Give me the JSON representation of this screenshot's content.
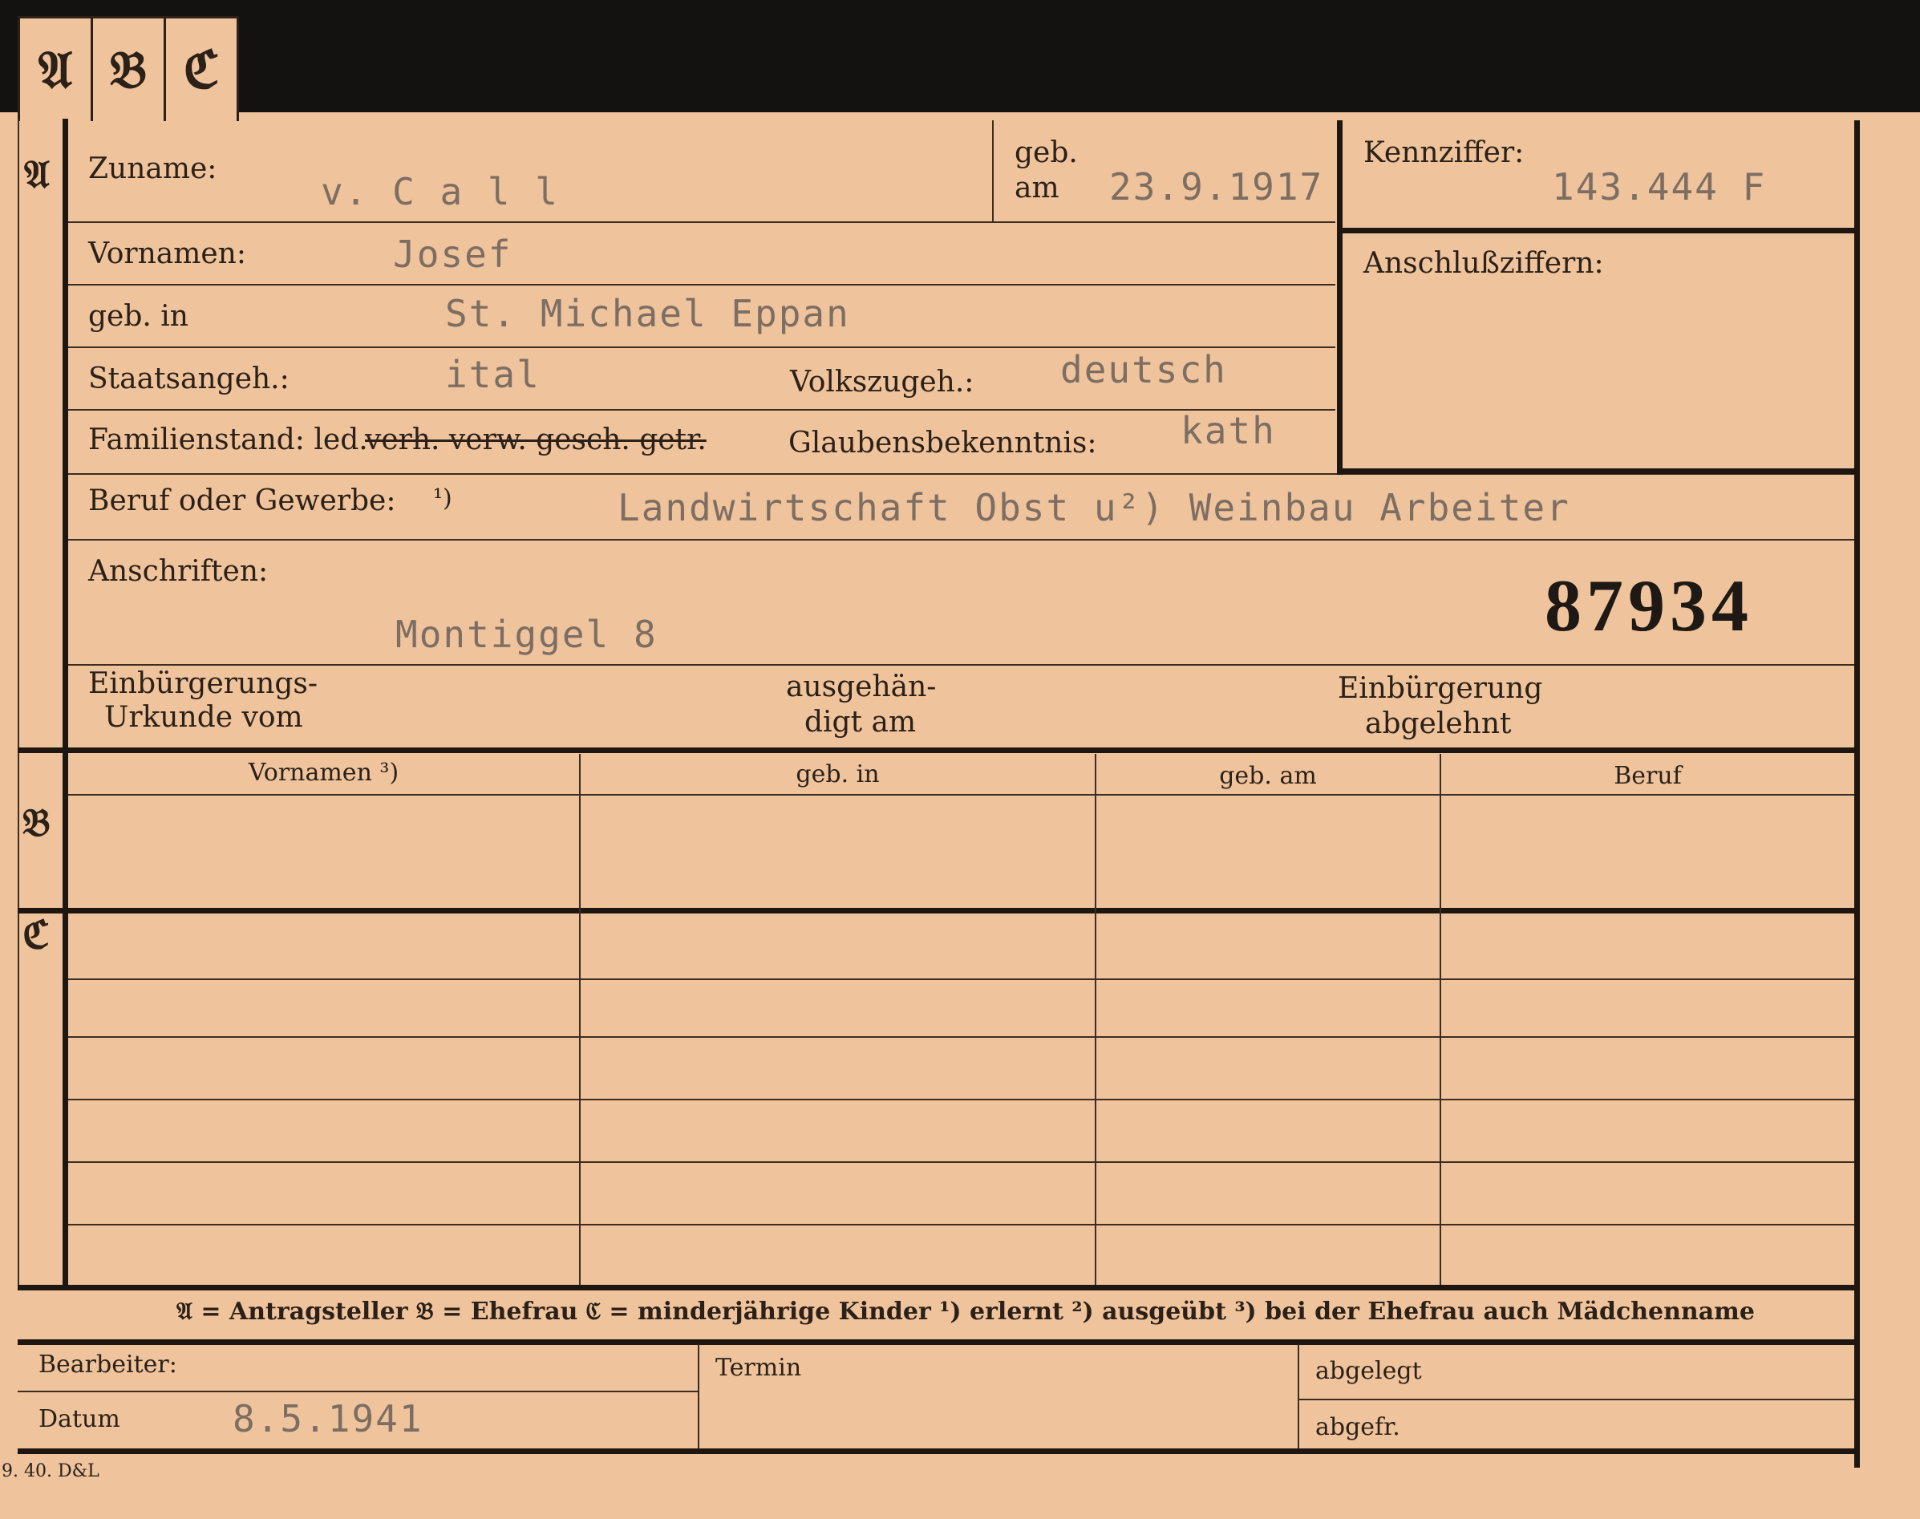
{
  "tabs": [
    "𝔄",
    "𝔅",
    "ℭ"
  ],
  "section_a": {
    "marker": "𝔄",
    "zuname_label": "Zuname:",
    "zuname_value": "v. C a l l",
    "geb_am_label_1": "geb.",
    "geb_am_label_2": "am",
    "geb_am_value": "23.9.1917",
    "kennziffer_label": "Kennziffer:",
    "kennziffer_value": "143.444  F",
    "vornamen_label": "Vornamen:",
    "vornamen_value": "Josef",
    "anschluss_label": "Anschlußziffern:",
    "geb_in_label": "geb. in",
    "geb_in_value": "St. Michael Eppan",
    "staatsangeh_label": "Staatsangeh.:",
    "staatsangeh_value": "ital",
    "volkszugeh_label": "Volkszugeh.:",
    "volkszugeh_value": "deutsch",
    "familienstand_label": "Familienstand: led.",
    "familienstand_struck": "verh. verw. gesch. getr.",
    "glauben_label": "Glaubensbekenntnis:",
    "glauben_value": "kath",
    "beruf_label": "Beruf oder Gewerbe:",
    "beruf_note": "¹)",
    "beruf_value": "Landwirtschaft Obst u²) Weinbau  Arbeiter",
    "anschriften_label": "Anschriften:",
    "anschriften_value": "Montiggel  8",
    "stamp_number": "87934",
    "einb_urkunde_1": "Einbürgerungs-",
    "einb_urkunde_2": "Urkunde vom",
    "ausgehaendigt_1": "ausgehän-",
    "ausgehaendigt_2": "digt am",
    "einb_abgelehnt_1": "Einbürgerung",
    "einb_abgelehnt_2": "abgelehnt"
  },
  "section_b": {
    "marker": "𝔅",
    "columns": [
      "Vornamen ³)",
      "geb. in",
      "geb. am",
      "Beruf"
    ]
  },
  "section_c": {
    "marker": "ℭ"
  },
  "legend": "𝔄 = Antragsteller   𝔅 = Ehefrau   ℭ = minderjährige Kinder   ¹) erlernt   ²) ausgeübt   ³) bei der Ehefrau auch Mädchenname",
  "footer": {
    "bearbeiter_label": "Bearbeiter:",
    "termin_label": "Termin",
    "abgelegt_label": "abgelegt",
    "datum_label": "Datum",
    "datum_value": "8.5.1941",
    "abgefr_label": "abgefr."
  },
  "print_code": "9. 40. D&L"
}
